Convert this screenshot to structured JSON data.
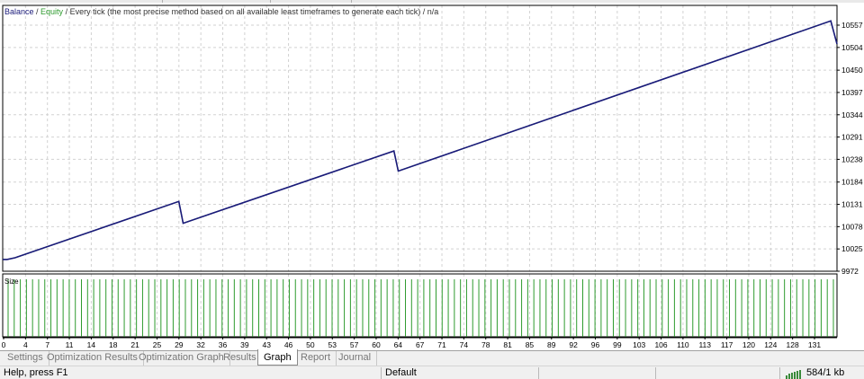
{
  "chart_data": {
    "type": "line",
    "header": {
      "balance_label": "Balance",
      "sep1": " / ",
      "equity_label": "Equity",
      "rest": " / Every tick (the most precise method based on all available least timeframes to generate each tick) / n/a"
    },
    "ylim": [
      9972,
      10604
    ],
    "y_ticks": [
      9972,
      10025,
      10078,
      10131,
      10184,
      10238,
      10291,
      10344,
      10397,
      10450,
      10504,
      10557
    ],
    "x_ticks": [
      "0",
      "4",
      "7",
      "11",
      "14",
      "18",
      "21",
      "25",
      "29",
      "32",
      "36",
      "39",
      "43",
      "46",
      "50",
      "53",
      "57",
      "60",
      "64",
      "67",
      "71",
      "74",
      "78",
      "81",
      "85",
      "89",
      "92",
      "96",
      "99",
      "103",
      "106",
      "110",
      "113",
      "117",
      "120",
      "124",
      "128",
      "131"
    ],
    "xlim": [
      0,
      135
    ],
    "series": [
      {
        "name": "Balance",
        "color": "#1a1a7a",
        "x": [
          0,
          0.7,
          2,
          28.5,
          29.2,
          63.3,
          64,
          134,
          135
        ],
        "y": [
          10000,
          10000,
          10004,
          10138,
          10086,
          10258,
          10210,
          10567,
          10512
        ]
      },
      {
        "name": "Equity",
        "color": "#2e9b2e",
        "x": [
          0,
          0.7,
          2,
          28.5,
          29.2,
          63.3,
          64,
          134,
          135
        ],
        "y": [
          10000,
          10000,
          10004,
          10138,
          10086,
          10258,
          10210,
          10567,
          10512
        ]
      }
    ],
    "size_panel": {
      "label": "Size",
      "bar_count": 136,
      "bar_value": 1,
      "color": "#2e9b2e"
    },
    "grid": true
  },
  "tabs": [
    {
      "label": "Settings",
      "active": false
    },
    {
      "label": "Optimization Results",
      "active": false
    },
    {
      "label": "Optimization Graph",
      "active": false
    },
    {
      "label": "Results",
      "active": false
    },
    {
      "label": "Graph",
      "active": true
    },
    {
      "label": "Report",
      "active": false
    },
    {
      "label": "Journal",
      "active": false
    }
  ],
  "status": {
    "help": "Help, press F1",
    "profile": "Default",
    "traffic": "584/1 kb"
  }
}
